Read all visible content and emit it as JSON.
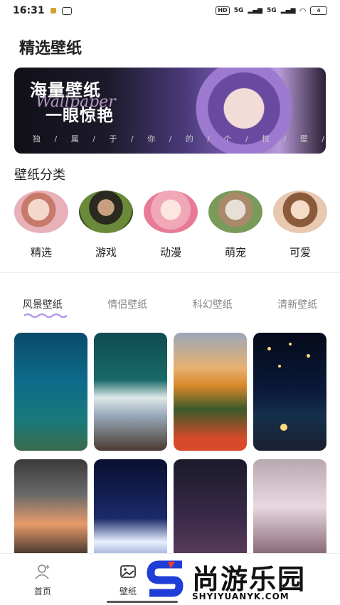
{
  "status_bar": {
    "time": "16:31",
    "network_hd": "HD",
    "network_5g_1": "5G",
    "network_5g_2": "5G",
    "battery": "4"
  },
  "page": {
    "title": "精选壁纸"
  },
  "banner": {
    "headline": "海量壁纸",
    "script_text": "Wallpaper",
    "subheadline": "一眼惊艳",
    "tagline": "独 / 属 / 于 / 你 / 的 / 个 / 性 / 壁 / 纸"
  },
  "categories": {
    "title": "壁纸分类",
    "items": [
      {
        "label": "精选"
      },
      {
        "label": "游戏"
      },
      {
        "label": "动漫"
      },
      {
        "label": "萌宠"
      },
      {
        "label": "可爱"
      }
    ]
  },
  "tabs": [
    {
      "label": "风景壁纸",
      "active": true
    },
    {
      "label": "情侣壁纸"
    },
    {
      "label": "科幻壁纸"
    },
    {
      "label": "清新壁纸"
    }
  ],
  "bottom_nav": {
    "home_label": "首页",
    "wallpaper_label": "壁纸"
  },
  "watermark": {
    "brand": "尚游乐园",
    "domain": "SHYIYUANYK.COM"
  },
  "colors": {
    "accent": "#b49be8"
  }
}
